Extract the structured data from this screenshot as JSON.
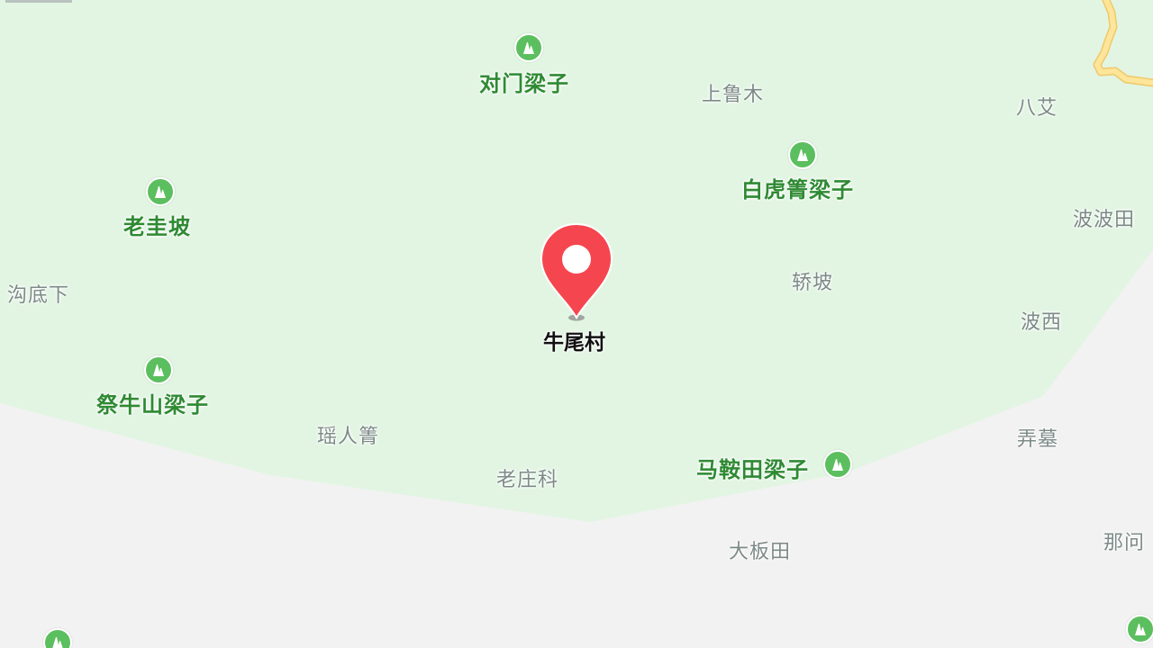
{
  "map": {
    "colors": {
      "land": "#f2f2f2",
      "forest": "#e2f5e3",
      "road": "#fde59a",
      "road_edge": "#f0c868",
      "peak_label": "#2f8a33",
      "peak_icon": "#5cbf5f",
      "place_label": "#7d8a87",
      "pin": "#f5464f"
    },
    "selected_place": {
      "name": "牛尾村"
    },
    "peaks": [
      {
        "id": "duimen",
        "name": "对门梁子"
      },
      {
        "id": "baihu",
        "name": "白虎箐梁子"
      },
      {
        "id": "laogui",
        "name": "老圭坡"
      },
      {
        "id": "jiniu",
        "name": "祭牛山梁子"
      },
      {
        "id": "maan",
        "name": "马鞍田梁子"
      }
    ],
    "places": [
      {
        "id": "shanglumu",
        "name": "上鲁木"
      },
      {
        "id": "bai",
        "name": "八艾"
      },
      {
        "id": "bobotian",
        "name": "波波田"
      },
      {
        "id": "goudixia",
        "name": "沟底下"
      },
      {
        "id": "jiaopo",
        "name": "轿坡"
      },
      {
        "id": "boxi",
        "name": "波西"
      },
      {
        "id": "yaorenqing",
        "name": "瑶人箐"
      },
      {
        "id": "laozhuangke",
        "name": "老庄科"
      },
      {
        "id": "nongmu",
        "name": "弄墓"
      },
      {
        "id": "dabantian",
        "name": "大板田"
      },
      {
        "id": "nawen",
        "name": "那问"
      }
    ]
  }
}
